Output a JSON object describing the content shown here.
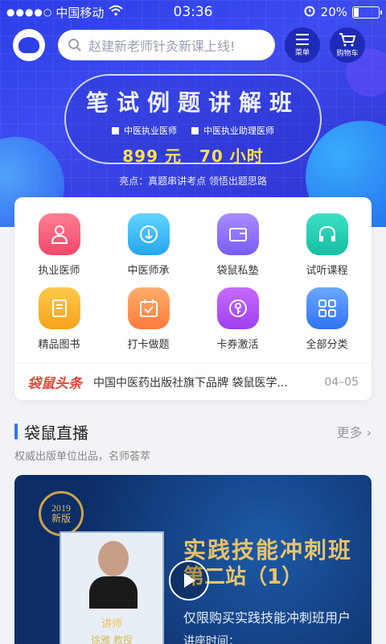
{
  "statusbar": {
    "carrier": "中国移动",
    "time": "03:36",
    "battery": "20%",
    "battery_level": 0.2
  },
  "topbar": {
    "search_placeholder": "赵建新老师针灸新课上线!",
    "menu_label": "菜单",
    "cart_label": "购物车"
  },
  "banner": {
    "title": "笔试例题讲解班",
    "option1": "中医执业医师",
    "option2": "中医执业助理医师",
    "price": "899 元",
    "hours": "70 小时",
    "highlight": "亮点：真题串讲考点 领悟出题思路"
  },
  "menu": [
    {
      "label": "执业医师",
      "icon": "doctor-icon"
    },
    {
      "label": "中医师承",
      "icon": "anchor-icon"
    },
    {
      "label": "袋鼠私塾",
      "icon": "wallet-icon"
    },
    {
      "label": "试听课程",
      "icon": "headphones-icon"
    },
    {
      "label": "精品图书",
      "icon": "book-icon"
    },
    {
      "label": "打卡做题",
      "icon": "calendar-check-icon"
    },
    {
      "label": "卡券激活",
      "icon": "key-icon"
    },
    {
      "label": "全部分类",
      "icon": "grid-icon"
    }
  ],
  "news": {
    "brand": "袋鼠头条",
    "text": "中国中医药出版社旗下品牌 袋鼠医学...",
    "date": "04–05"
  },
  "live": {
    "section_title": "袋鼠直播",
    "more": "更多",
    "subtitle": "权威出版单位出品，名师荟萃",
    "badge_year": "2019",
    "badge_text": "新版",
    "course_title1": "实践技能冲刺班",
    "course_title2": "第二站（1）",
    "course_sub": "仅限购买实践技能冲刺班用户",
    "course_time": "讲座时间：",
    "lecturer_role": "讲师",
    "lecturer_name": "徐雅  教授"
  }
}
